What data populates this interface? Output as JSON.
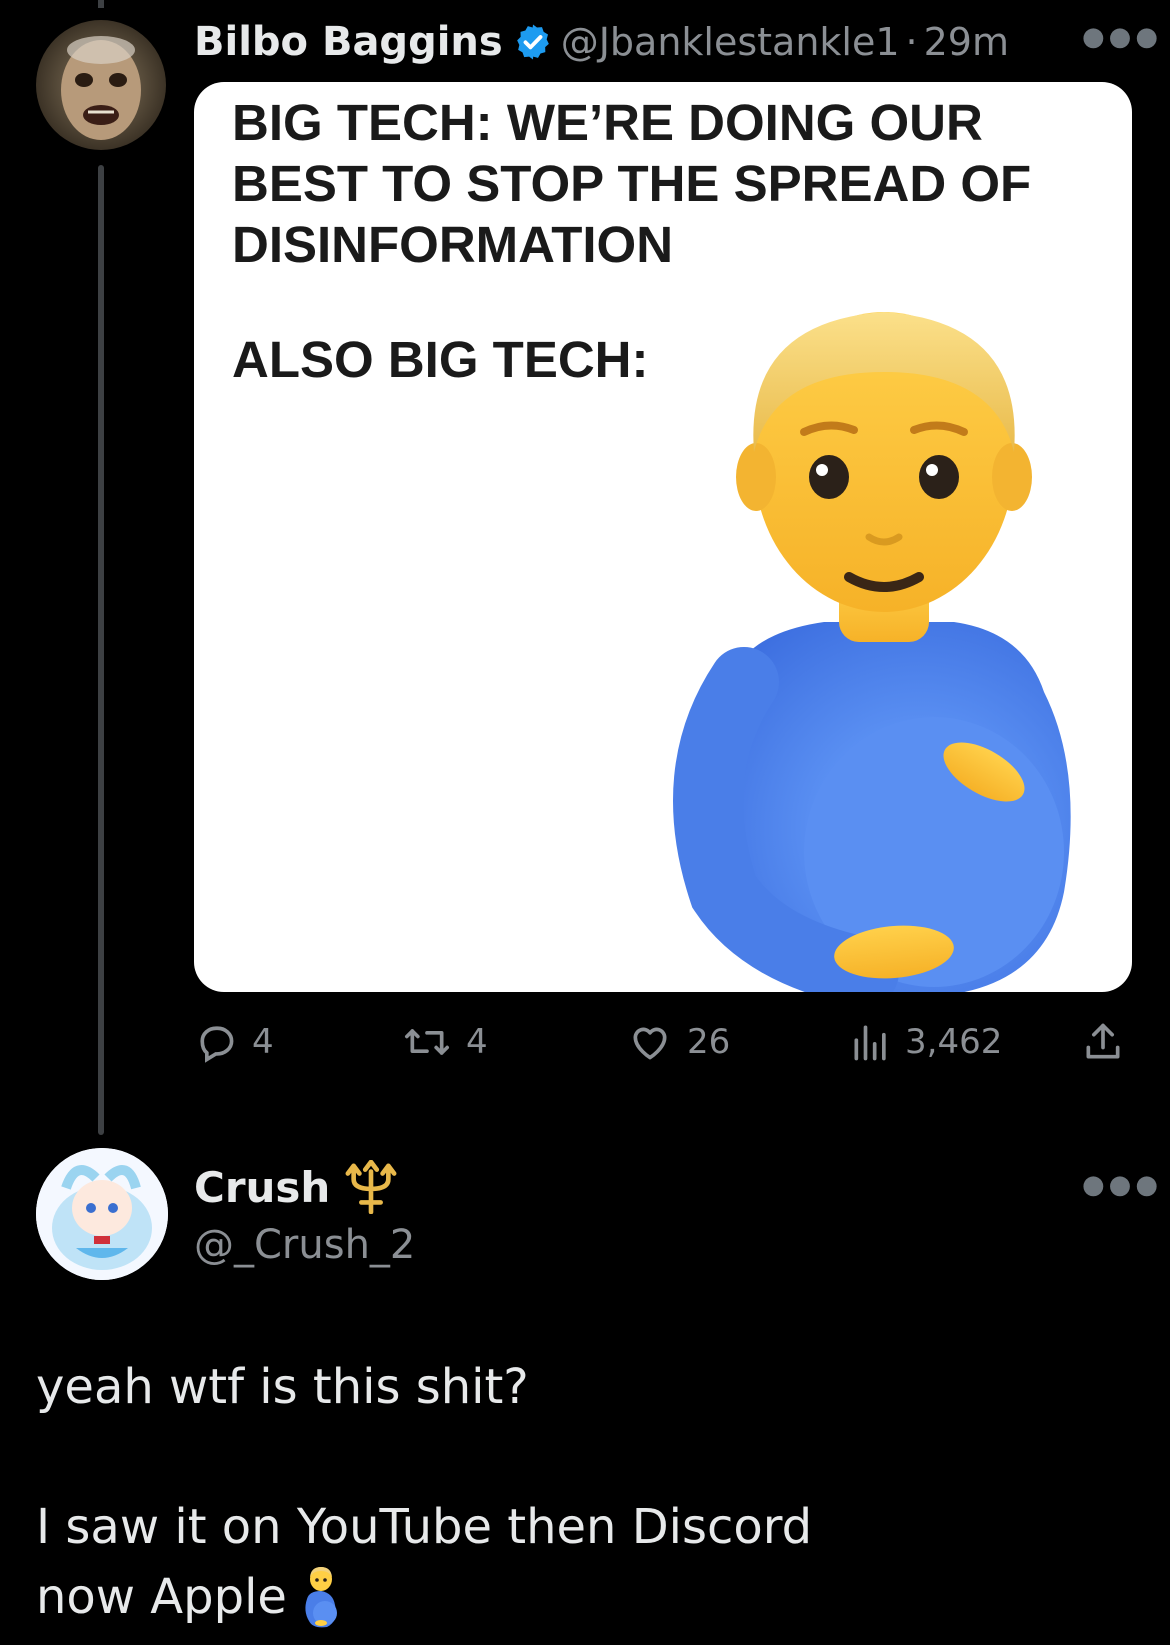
{
  "tweet": {
    "author_name": "Bilbo Baggins",
    "author_handle": "@Jbanklestankle1",
    "separator": "·",
    "time": "29m",
    "verified": true,
    "meme": {
      "top_text": "BIG TECH: WE’RE DOING OUR BEST TO STOP THE SPREAD OF DISINFORMATION",
      "bottom_text": "ALSO BIG TECH:",
      "image_icon": "pregnant-man-emoji"
    },
    "stats": {
      "replies": "4",
      "retweets": "4",
      "likes": "26",
      "views": "3,462"
    }
  },
  "reply": {
    "author_name": "Crush",
    "name_emoji": "trident-icon",
    "author_handle": "@_Crush_2",
    "text_line1": "yeah wtf is this shit?",
    "text_line2": "I saw it on YouTube then Discord",
    "text_line3": "now Apple",
    "trailing_emoji": "pregnant-man-emoji"
  },
  "colors": {
    "background": "#000000",
    "text": "#e7e9ea",
    "muted": "#8b8f94",
    "verified_blue": "#1d9bf0",
    "trident_gold": "#e8b84a"
  }
}
